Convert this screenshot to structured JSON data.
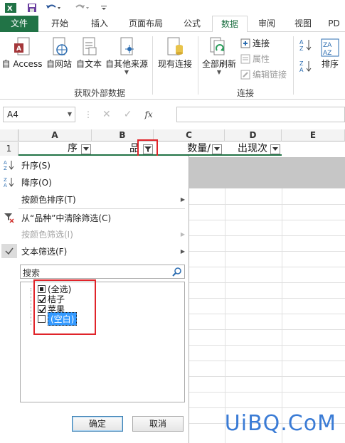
{
  "qat": {
    "save_icon": "save-icon",
    "undo_icon": "undo-icon",
    "redo_icon": "redo-icon"
  },
  "tabs": [
    {
      "label": "文件"
    },
    {
      "label": "开始"
    },
    {
      "label": "插入"
    },
    {
      "label": "页面布局"
    },
    {
      "label": "公式"
    },
    {
      "label": "数据"
    },
    {
      "label": "审阅"
    },
    {
      "label": "视图"
    },
    {
      "label": "PD"
    }
  ],
  "ribbon": {
    "access": "自 Access",
    "web": "自网站",
    "text": "自文本",
    "other": "自其他来源",
    "existing": "现有连接",
    "refresh_all": "全部刷新",
    "connections": "连接",
    "properties": "属性",
    "edit_links": "编辑链接",
    "sort": "排序",
    "group_external": "获取外部数据",
    "group_connections": "连接"
  },
  "formula_bar": {
    "name_box": "A4",
    "fx": "fx"
  },
  "columns": [
    "A",
    "B",
    "C",
    "D",
    "E"
  ],
  "row1": {
    "num": "1",
    "a": "序",
    "b": "品",
    "c": "数量/",
    "d": "出现次"
  },
  "menu": {
    "sort_asc": "升序(S)",
    "sort_desc": "降序(O)",
    "sort_by_color": "按颜色排序(T)",
    "clear_filter": "从“品种”中清除筛选(C)",
    "filter_by_color": "按颜色筛选(I)",
    "text_filter": "文本筛选(F)",
    "search_placeholder": "搜索",
    "items": [
      {
        "label": "(全选)",
        "state": "partial"
      },
      {
        "label": "桔子",
        "state": "checked"
      },
      {
        "label": "苹果",
        "state": "checked"
      },
      {
        "label": "(空白)",
        "state": "unchecked"
      }
    ],
    "ok": "确定",
    "cancel": "取消"
  },
  "watermark": "UiBQ.CoM",
  "colors": {
    "excel_green": "#217346",
    "highlight_red": "#e0242a",
    "selection_blue": "#3399ff"
  }
}
